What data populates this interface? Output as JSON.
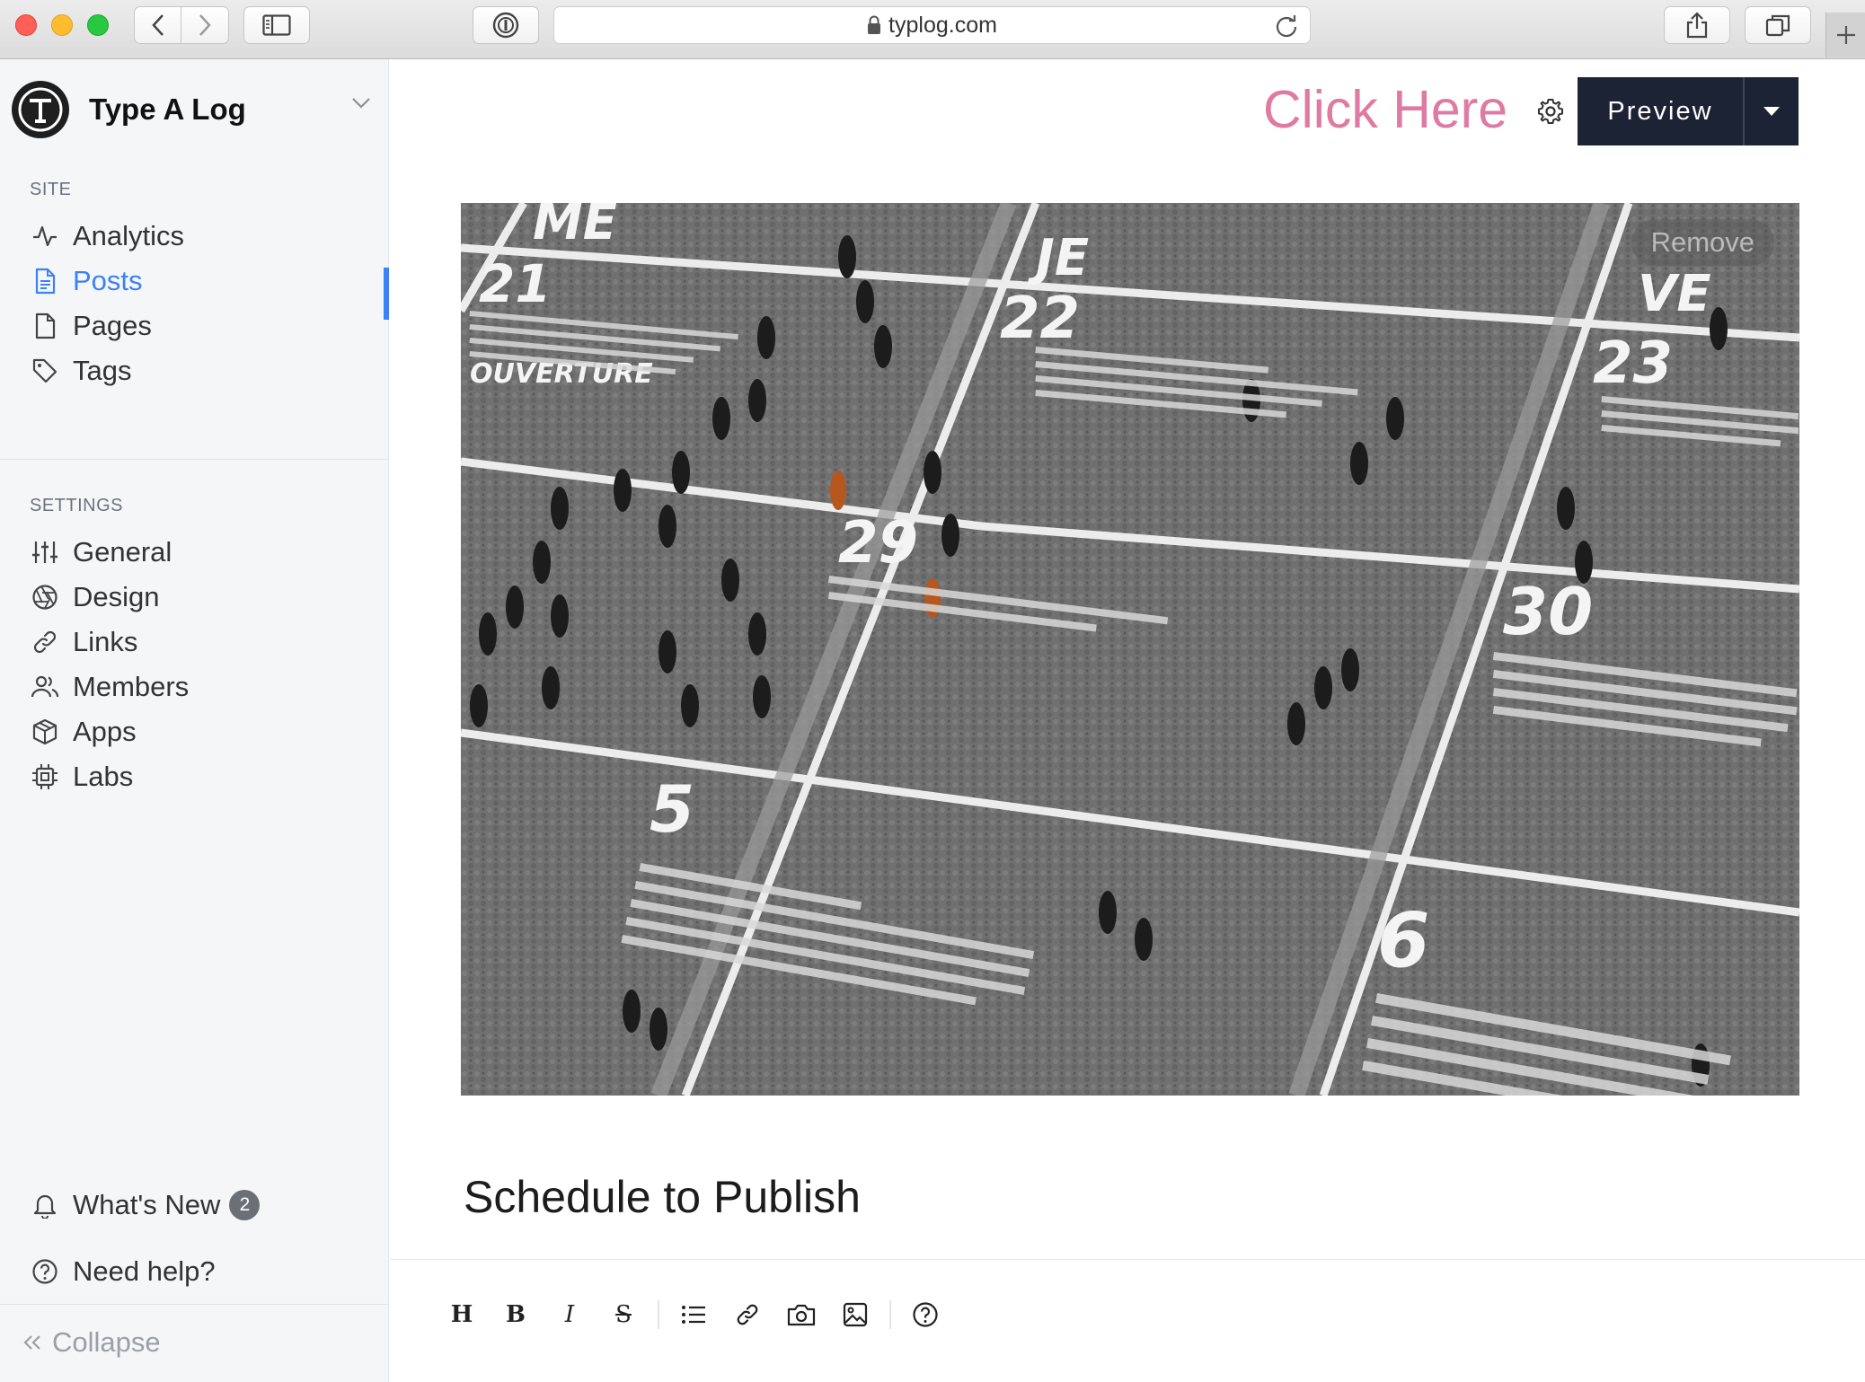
{
  "browser": {
    "url": "typlog.com"
  },
  "sidebar": {
    "brand_name": "Type A Log",
    "site_section_label": "SITE",
    "site_items": [
      {
        "label": "Analytics"
      },
      {
        "label": "Posts"
      },
      {
        "label": "Pages"
      },
      {
        "label": "Tags"
      }
    ],
    "settings_section_label": "SETTINGS",
    "settings_items": [
      {
        "label": "General"
      },
      {
        "label": "Design"
      },
      {
        "label": "Links"
      },
      {
        "label": "Members"
      },
      {
        "label": "Apps"
      },
      {
        "label": "Labs"
      }
    ],
    "whats_new_label": "What's New",
    "whats_new_count": "2",
    "help_label": "Need help?",
    "collapse_label": "Collapse"
  },
  "header": {
    "annotation": "Click Here",
    "preview_label": "Preview"
  },
  "cover": {
    "remove_label": "Remove"
  },
  "editor": {
    "title": "Schedule to Publish",
    "toolbar": {
      "heading": "H",
      "bold": "B",
      "italic": "I",
      "strike": "S"
    }
  },
  "colors": {
    "accent": "#3b82f6",
    "preview_bg": "#1b2334",
    "annotation": "#df7aa2"
  },
  "icons": {
    "analytics": "activity-icon",
    "posts": "document-icon",
    "pages": "file-icon",
    "tags": "tag-icon",
    "general": "sliders-icon",
    "design": "aperture-icon",
    "links": "link-icon",
    "members": "users-icon",
    "apps": "box-icon",
    "labs": "chip-icon"
  }
}
